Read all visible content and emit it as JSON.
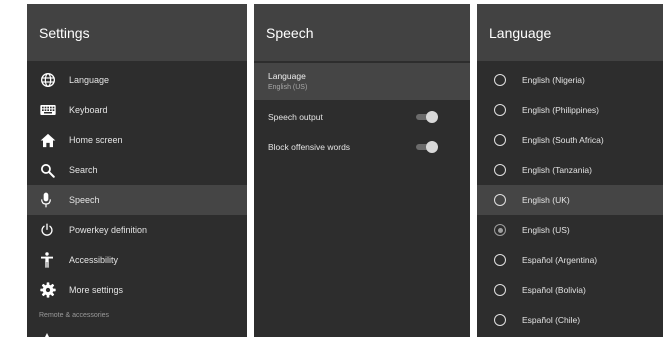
{
  "settings": {
    "title": "Settings",
    "items": [
      {
        "label": "Language",
        "icon": "globe-icon"
      },
      {
        "label": "Keyboard",
        "icon": "keyboard-icon"
      },
      {
        "label": "Home screen",
        "icon": "home-icon"
      },
      {
        "label": "Search",
        "icon": "search-icon"
      },
      {
        "label": "Speech",
        "icon": "microphone-icon"
      },
      {
        "label": "Powerkey definition",
        "icon": "power-icon"
      },
      {
        "label": "Accessibility",
        "icon": "accessibility-icon"
      },
      {
        "label": "More settings",
        "icon": "gear-icon"
      }
    ],
    "selected_index": 4,
    "section_label": "Remote & accessories"
  },
  "speech": {
    "title": "Speech",
    "language": {
      "title": "Language",
      "value": "English (US)"
    },
    "speech_output": {
      "label": "Speech output",
      "enabled": true
    },
    "block_offensive": {
      "label": "Block offensive words",
      "enabled": true
    }
  },
  "language": {
    "title": "Language",
    "options": [
      "English (Nigeria)",
      "English (Philippines)",
      "English (South Africa)",
      "English (Tanzania)",
      "English (UK)",
      "English (US)",
      "Español (Argentina)",
      "Español (Bolivia)",
      "Español (Chile)"
    ],
    "focused_index": 4,
    "selected_index": 5
  },
  "colors": {
    "panel_bg": "#2d2d2d",
    "header_bg": "#424242",
    "highlight_bg": "#454545",
    "text": "#e4e4e4"
  }
}
